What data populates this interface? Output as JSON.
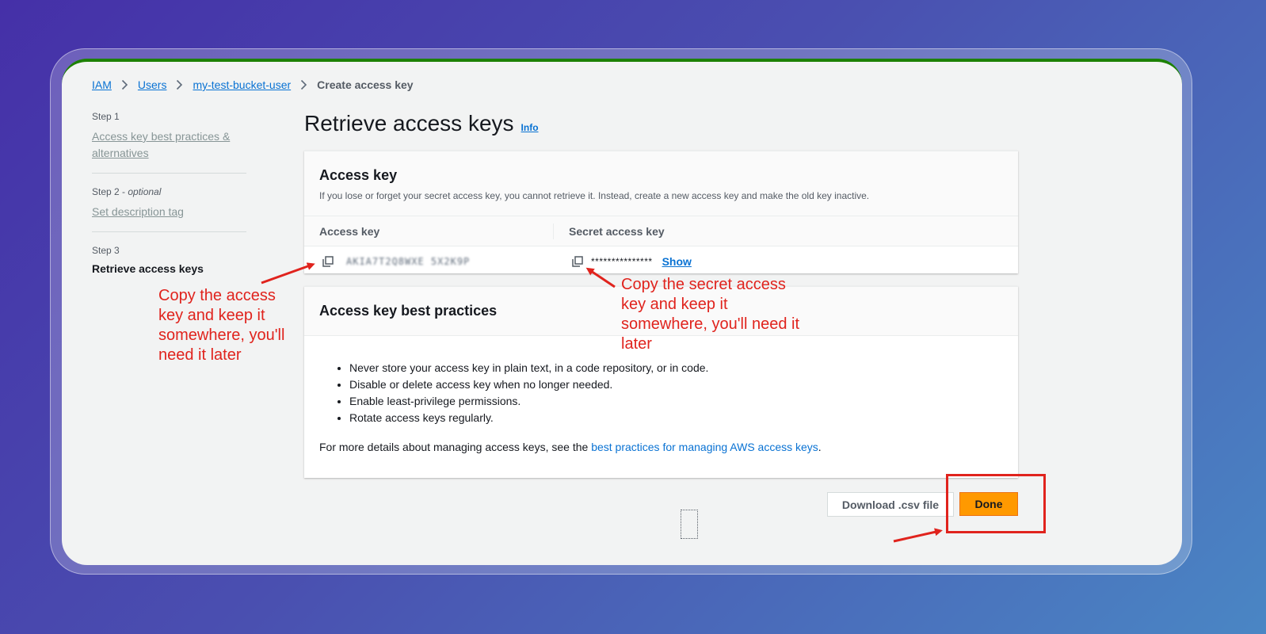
{
  "breadcrumb": {
    "items": [
      "IAM",
      "Users",
      "my-test-bucket-user"
    ],
    "current": "Create access key"
  },
  "steps": [
    {
      "number": "Step 1",
      "optional": "",
      "label": "Access key best practices & alternatives"
    },
    {
      "number": "Step 2 - ",
      "optional": "optional",
      "label": "Set description tag"
    },
    {
      "number": "Step 3",
      "optional": "",
      "label": "Retrieve access keys"
    }
  ],
  "page": {
    "title": "Retrieve access keys",
    "info_label": "Info"
  },
  "access_key_panel": {
    "title": "Access key",
    "description": "If you lose or forget your secret access key, you cannot retrieve it. Instead, create a new access key and make the old key inactive.",
    "col_access_key": "Access key",
    "col_secret_key": "Secret access key",
    "access_key_value": "AKIA7T2Q8WXE 5X2K9P",
    "secret_key_masked": "***************",
    "show_label": "Show"
  },
  "best_practices_panel": {
    "title": "Access key best practices",
    "bullets": [
      "Never store your access key in plain text, in a code repository, or in code.",
      "Disable or delete access key when no longer needed.",
      "Enable least-privilege permissions.",
      "Rotate access keys regularly."
    ],
    "more_prefix": "For more details about managing access keys, see the ",
    "more_link": "best practices for managing AWS access keys",
    "more_suffix": "."
  },
  "buttons": {
    "download_csv": "Download .csv file",
    "done": "Done"
  },
  "annotations": {
    "access_key_note": "Copy the access key and keep it somewhere, you'll need it later",
    "secret_key_note": "Copy the secret access key and keep it somewhere, you'll need it later",
    "color": "#e0231d"
  },
  "colors": {
    "link": "#0972d3",
    "primary_button": "#ff9900",
    "success_bar": "#1d8102"
  }
}
